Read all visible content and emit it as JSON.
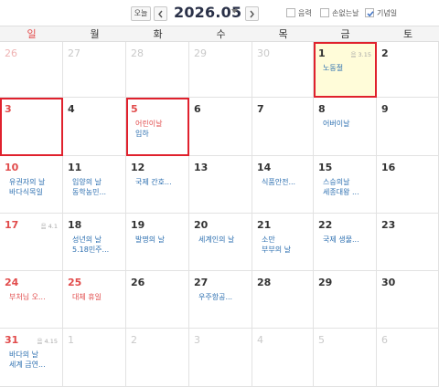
{
  "header": {
    "today_label": "오늘",
    "title": "2026.05",
    "options": [
      {
        "label": "음력",
        "checked": false
      },
      {
        "label": "손없는날",
        "checked": false
      },
      {
        "label": "기념일",
        "checked": true
      }
    ]
  },
  "weekdays": [
    "일",
    "월",
    "화",
    "수",
    "목",
    "금",
    "토"
  ],
  "weeks": [
    [
      {
        "num": "26",
        "other": true,
        "red": true,
        "lunar": "",
        "events": []
      },
      {
        "num": "27",
        "other": true,
        "lunar": "",
        "events": []
      },
      {
        "num": "28",
        "other": true,
        "lunar": "",
        "events": []
      },
      {
        "num": "29",
        "other": true,
        "lunar": "",
        "events": []
      },
      {
        "num": "30",
        "other": true,
        "lunar": "",
        "events": []
      },
      {
        "num": "1",
        "today": true,
        "lunar": "음 3.15",
        "events": [
          {
            "text": "노동절",
            "holiday": false
          }
        ]
      },
      {
        "num": "2",
        "lunar": "",
        "events": []
      }
    ],
    [
      {
        "num": "3",
        "red": true,
        "lunar": "",
        "events": []
      },
      {
        "num": "4",
        "lunar": "",
        "events": []
      },
      {
        "num": "5",
        "red": true,
        "lunar": "",
        "events": [
          {
            "text": "어린이날",
            "holiday": true
          },
          {
            "text": "입하",
            "holiday": false
          }
        ]
      },
      {
        "num": "6",
        "lunar": "",
        "events": []
      },
      {
        "num": "7",
        "lunar": "",
        "events": []
      },
      {
        "num": "8",
        "lunar": "",
        "events": [
          {
            "text": "어버이날",
            "holiday": false
          }
        ]
      },
      {
        "num": "9",
        "lunar": "",
        "events": []
      }
    ],
    [
      {
        "num": "10",
        "red": true,
        "lunar": "",
        "events": [
          {
            "text": "유권자의 날",
            "holiday": false
          },
          {
            "text": "바다식목일",
            "holiday": false
          }
        ]
      },
      {
        "num": "11",
        "lunar": "",
        "events": [
          {
            "text": "입양의 날",
            "holiday": false
          },
          {
            "text": "동학농민...",
            "holiday": false
          }
        ]
      },
      {
        "num": "12",
        "lunar": "",
        "events": [
          {
            "text": "국제 간호...",
            "holiday": false
          }
        ]
      },
      {
        "num": "13",
        "lunar": "",
        "events": []
      },
      {
        "num": "14",
        "lunar": "",
        "events": [
          {
            "text": "식품안전...",
            "holiday": false
          }
        ]
      },
      {
        "num": "15",
        "lunar": "",
        "events": [
          {
            "text": "스승의날",
            "holiday": false
          },
          {
            "text": "세종대왕 ...",
            "holiday": false
          }
        ]
      },
      {
        "num": "16",
        "lunar": "",
        "events": []
      }
    ],
    [
      {
        "num": "17",
        "red": true,
        "lunar": "음 4.1",
        "events": []
      },
      {
        "num": "18",
        "lunar": "",
        "events": [
          {
            "text": "성년의 날",
            "holiday": false
          },
          {
            "text": "5.18민주...",
            "holiday": false
          }
        ]
      },
      {
        "num": "19",
        "lunar": "",
        "events": [
          {
            "text": "발명의 날",
            "holiday": false
          }
        ]
      },
      {
        "num": "20",
        "lunar": "",
        "events": [
          {
            "text": "세계인의 날",
            "holiday": false
          }
        ]
      },
      {
        "num": "21",
        "lunar": "",
        "events": [
          {
            "text": "소만",
            "holiday": false
          },
          {
            "text": "부부의 날",
            "holiday": false
          }
        ]
      },
      {
        "num": "22",
        "lunar": "",
        "events": [
          {
            "text": "국제 생물...",
            "holiday": false
          }
        ]
      },
      {
        "num": "23",
        "lunar": "",
        "events": []
      }
    ],
    [
      {
        "num": "24",
        "red": true,
        "lunar": "",
        "events": [
          {
            "text": "부처님 오...",
            "holiday": true
          }
        ]
      },
      {
        "num": "25",
        "red": true,
        "lunar": "",
        "events": [
          {
            "text": "대체 휴일",
            "holiday": true
          }
        ]
      },
      {
        "num": "26",
        "lunar": "",
        "events": []
      },
      {
        "num": "27",
        "lunar": "",
        "events": [
          {
            "text": "우주항공...",
            "holiday": false
          }
        ]
      },
      {
        "num": "28",
        "lunar": "",
        "events": []
      },
      {
        "num": "29",
        "lunar": "",
        "events": []
      },
      {
        "num": "30",
        "lunar": "",
        "events": []
      }
    ],
    [
      {
        "num": "31",
        "red": true,
        "lunar": "음 4.15",
        "events": [
          {
            "text": "바다의 날",
            "holiday": false
          },
          {
            "text": "세계 금연...",
            "holiday": false
          }
        ]
      },
      {
        "num": "1",
        "other": true,
        "lunar": "",
        "events": []
      },
      {
        "num": "2",
        "other": true,
        "lunar": "",
        "events": []
      },
      {
        "num": "3",
        "other": true,
        "lunar": "",
        "events": []
      },
      {
        "num": "4",
        "other": true,
        "lunar": "",
        "events": []
      },
      {
        "num": "5",
        "other": true,
        "lunar": "",
        "events": []
      },
      {
        "num": "6",
        "other": true,
        "lunar": "",
        "events": []
      }
    ]
  ],
  "highlighted_cells": [
    {
      "week": 0,
      "day": 5
    },
    {
      "week": 1,
      "day": 0
    },
    {
      "week": 1,
      "day": 2
    }
  ],
  "colors": {
    "holiday_red": "#e14b4b",
    "event_blue": "#2c6fb0",
    "today_bg": "#fffcd9",
    "highlight_red": "#e0212d",
    "title_navy": "#2a3148"
  }
}
